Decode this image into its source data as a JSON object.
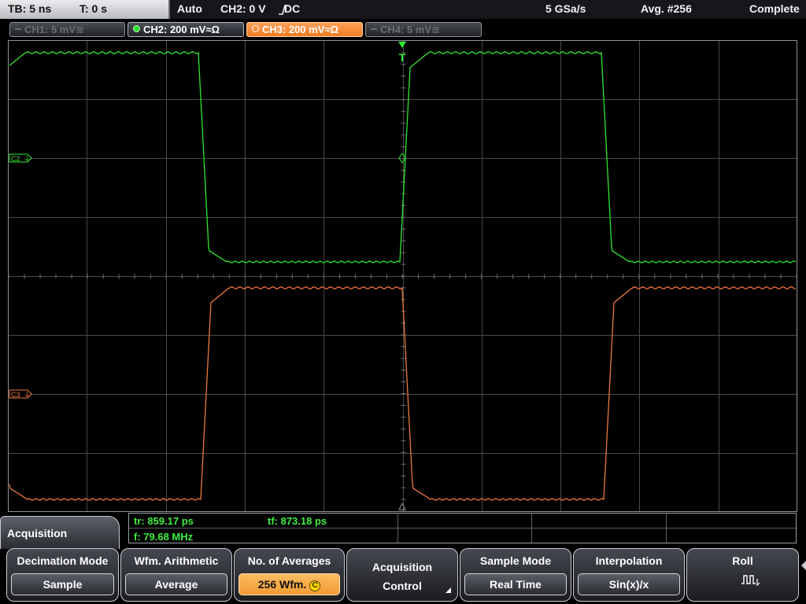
{
  "topbar": {
    "timebase": "TB: 5 ns",
    "trigger_time": "T: 0 s",
    "trigger_mode": "Auto",
    "trigger_source": "CH2: 0 V",
    "trigger_slope_icon": "rising-edge-icon",
    "coupling": "DC",
    "sample_rate": "5 GSa/s",
    "averages": "Avg. #256",
    "status": "Complete"
  },
  "channels": [
    {
      "label": "CH1: 5 mV",
      "suffix": "≅",
      "state": "off"
    },
    {
      "label": "CH2: 200 mV",
      "suffix": "≈Ω",
      "state": "on",
      "color": "#26e12a"
    },
    {
      "label": "CH3: 200 mV",
      "suffix": "≈Ω",
      "state": "selected",
      "color": "#f07d22"
    },
    {
      "label": "CH4: 5 mV",
      "suffix": "≅",
      "state": "off"
    }
  ],
  "display": {
    "trigger_marker": "T",
    "ch2_marker": "C2",
    "ch3_marker": "C3",
    "ch2_color": "#2ee82e",
    "ch3_color": "#f07a3c",
    "grid_color": "#4a4a4a"
  },
  "measurements": {
    "rise_time": "tr: 859.17 ps",
    "fall_time": "tf: 873.18 ps",
    "frequency": "f: 79.68 MHz"
  },
  "menu": {
    "title": "Acquisition",
    "softkeys": [
      {
        "title": "Decimation Mode",
        "value": "Sample"
      },
      {
        "title": "Wfm. Arithmetic",
        "value": "Average"
      },
      {
        "title": "No. of Averages",
        "value": "256 Wfm.",
        "knob_icon": "C"
      },
      {
        "line1": "Acquisition",
        "line2": "Control"
      },
      {
        "title": "Sample Mode",
        "value": "Real Time"
      },
      {
        "title": "Interpolation",
        "value": "Sin(x)/x"
      },
      {
        "title": "Roll",
        "icon": "roll-waveform-icon"
      }
    ]
  }
}
